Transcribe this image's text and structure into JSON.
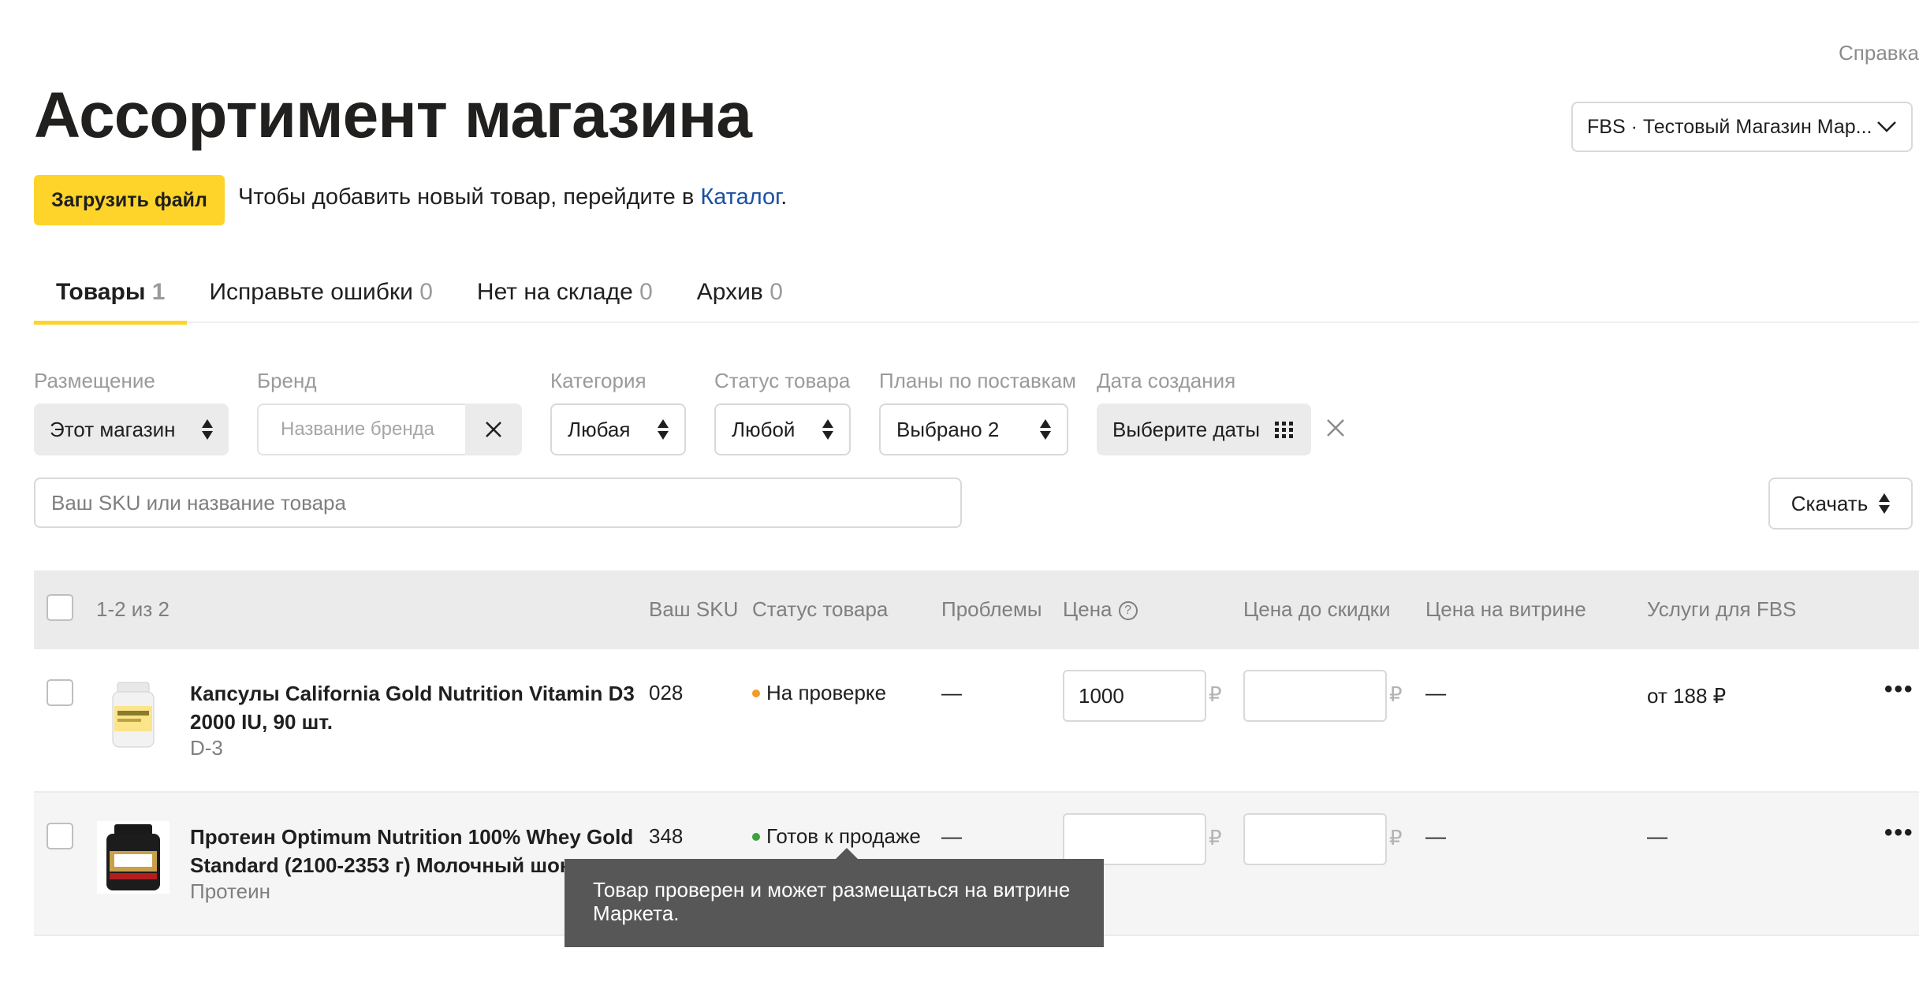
{
  "header": {
    "help_link": "Справка",
    "title": "Ассортимент магазина",
    "store_selector": "FBS · Тестовый Магазин Мар..."
  },
  "actions": {
    "upload_button": "Загрузить файл",
    "hint_text": "Чтобы добавить новый товар, перейдите в",
    "hint_link": "Каталог",
    "hint_end": "."
  },
  "tabs": [
    {
      "label": "Товары",
      "count": "1"
    },
    {
      "label": "Исправьте ошибки",
      "count": "0"
    },
    {
      "label": "Нет на складе",
      "count": "0"
    },
    {
      "label": "Архив",
      "count": "0"
    }
  ],
  "filters": {
    "placement": {
      "label": "Размещение",
      "value": "Этот магазин"
    },
    "brand": {
      "label": "Бренд",
      "placeholder": "Название бренда"
    },
    "category": {
      "label": "Категория",
      "value": "Любая"
    },
    "status": {
      "label": "Статус товара",
      "value": "Любой"
    },
    "plans": {
      "label": "Планы по поставкам",
      "value": "Выбрано 2"
    },
    "date": {
      "label": "Дата создания",
      "value": "Выберите даты"
    }
  },
  "search": {
    "placeholder": "Ваш SKU или название товара"
  },
  "download_button": "Скачать",
  "table": {
    "range": "1-2 из 2",
    "columns": {
      "sku": "Ваш SKU",
      "status": "Статус товара",
      "problems": "Проблемы",
      "price": "Цена",
      "price_before": "Цена до скидки",
      "price_showcase": "Цена на витрине",
      "fbs_services": "Услуги для FBS"
    },
    "rows": [
      {
        "name": "Капсулы California Gold Nutrition Vitamin D3 2000 IU, 90 шт.",
        "subtitle": "D-3",
        "sku": "028",
        "status": "На проверке",
        "status_color": "#f59a23",
        "problems": "—",
        "price": "1000",
        "price_before": "",
        "price_showcase": "—",
        "fbs": "от 188 ₽",
        "currency": "₽"
      },
      {
        "name": "Протеин Optimum Nutrition 100% Whey Gold Standard (2100-2353 г) Молочный шоколад",
        "subtitle": "Протеин",
        "sku": "348",
        "status": "Готов к продаже",
        "status_color": "#3aa33a",
        "problems": "—",
        "price": "",
        "price_before": "",
        "price_showcase": "—",
        "fbs": "—",
        "currency": "₽"
      }
    ]
  },
  "tooltip": "Товар проверен и может размещаться на витрине Маркета.",
  "colors": {
    "accent_yellow": "#fed42b",
    "link_blue": "#1a4fa3"
  }
}
